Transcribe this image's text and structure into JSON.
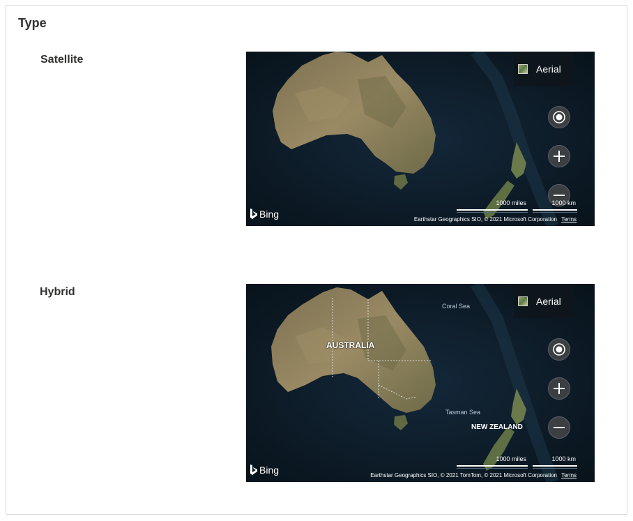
{
  "section": {
    "title": "Type"
  },
  "maps": [
    {
      "label": "Satellite",
      "style_picker_label": "Aerial",
      "branding": "Bing",
      "scale_miles": "1000 miles",
      "scale_km": "1000 km",
      "copyright": "Earthstar Geographics SIO, © 2021 Microsoft Corporation",
      "terms": "Terms",
      "labels": []
    },
    {
      "label": "Hybrid",
      "style_picker_label": "Aerial",
      "branding": "Bing",
      "scale_miles": "1000 miles",
      "scale_km": "1000 km",
      "copyright": "Earthstar Geographics SIO, © 2021 TomTom, © 2021 Microsoft Corporation",
      "terms": "Terms",
      "labels": {
        "australia": "AUSTRALIA",
        "coral_sea": "Coral Sea",
        "tasman_sea": "Tasman Sea",
        "new_zealand": "NEW ZEALAND"
      }
    }
  ],
  "icons": {
    "locate": "locate-me-icon",
    "zoom_in": "zoom-in-icon",
    "zoom_out": "zoom-out-icon",
    "bing": "bing-logo-icon",
    "aerial_thumb": "aerial-thumbnail-icon"
  },
  "colors": {
    "ocean": "#0c1a22",
    "land": "#8a7d5e",
    "control_bg": "#3c3f42"
  }
}
